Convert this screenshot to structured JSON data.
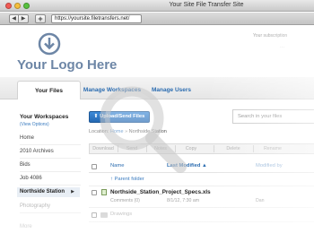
{
  "window": {
    "title": "Your Site File Transfer Site"
  },
  "browser": {
    "back_label": "◀",
    "forward_label": "▶",
    "add_label": "+",
    "url": "https://yoursite.filetransfers.net/"
  },
  "header": {
    "logo_text": "Your Logo Here",
    "subscription_text": "Your subscription"
  },
  "tabs": [
    {
      "label": "Your Files"
    },
    {
      "label": "Manage Workspaces"
    },
    {
      "label": "Manage Users"
    }
  ],
  "sidebar": {
    "title": "Your Workspaces",
    "subtitle": "(View Options)",
    "items": [
      {
        "label": "Home"
      },
      {
        "label": "2010 Archives"
      },
      {
        "label": "Bids"
      },
      {
        "label": "Job 4086"
      },
      {
        "label": "Northside Station",
        "active": true
      },
      {
        "label": "Photography"
      },
      {
        "label": "More"
      }
    ]
  },
  "main": {
    "upload_button": "Upload/Send Files",
    "search_placeholder": "Search in your files",
    "location_label": "Location:",
    "location_home": "Home",
    "location_sep": "»",
    "location_current": "Northside Station",
    "actions": [
      "Download",
      "Send",
      "Notes",
      "Copy",
      "Delete",
      "Rename"
    ],
    "columns": {
      "name": "Name",
      "modified": "Last Modified",
      "sort_indicator": "▲",
      "modified_by": "Modified by"
    },
    "parent_folder": "Parent folder",
    "parent_arrow": "↑",
    "files": [
      {
        "name": "Northside_Station_Project_Specs.xls",
        "comments": "Comments (0)",
        "date": "8/1/12, 7:30 am",
        "by": "Dan"
      }
    ],
    "folders": [
      {
        "name": "Drawings"
      }
    ]
  },
  "colors": {
    "accent": "#2b6cb0",
    "button": "#2e7ac6",
    "logo": "#6d86a6"
  }
}
